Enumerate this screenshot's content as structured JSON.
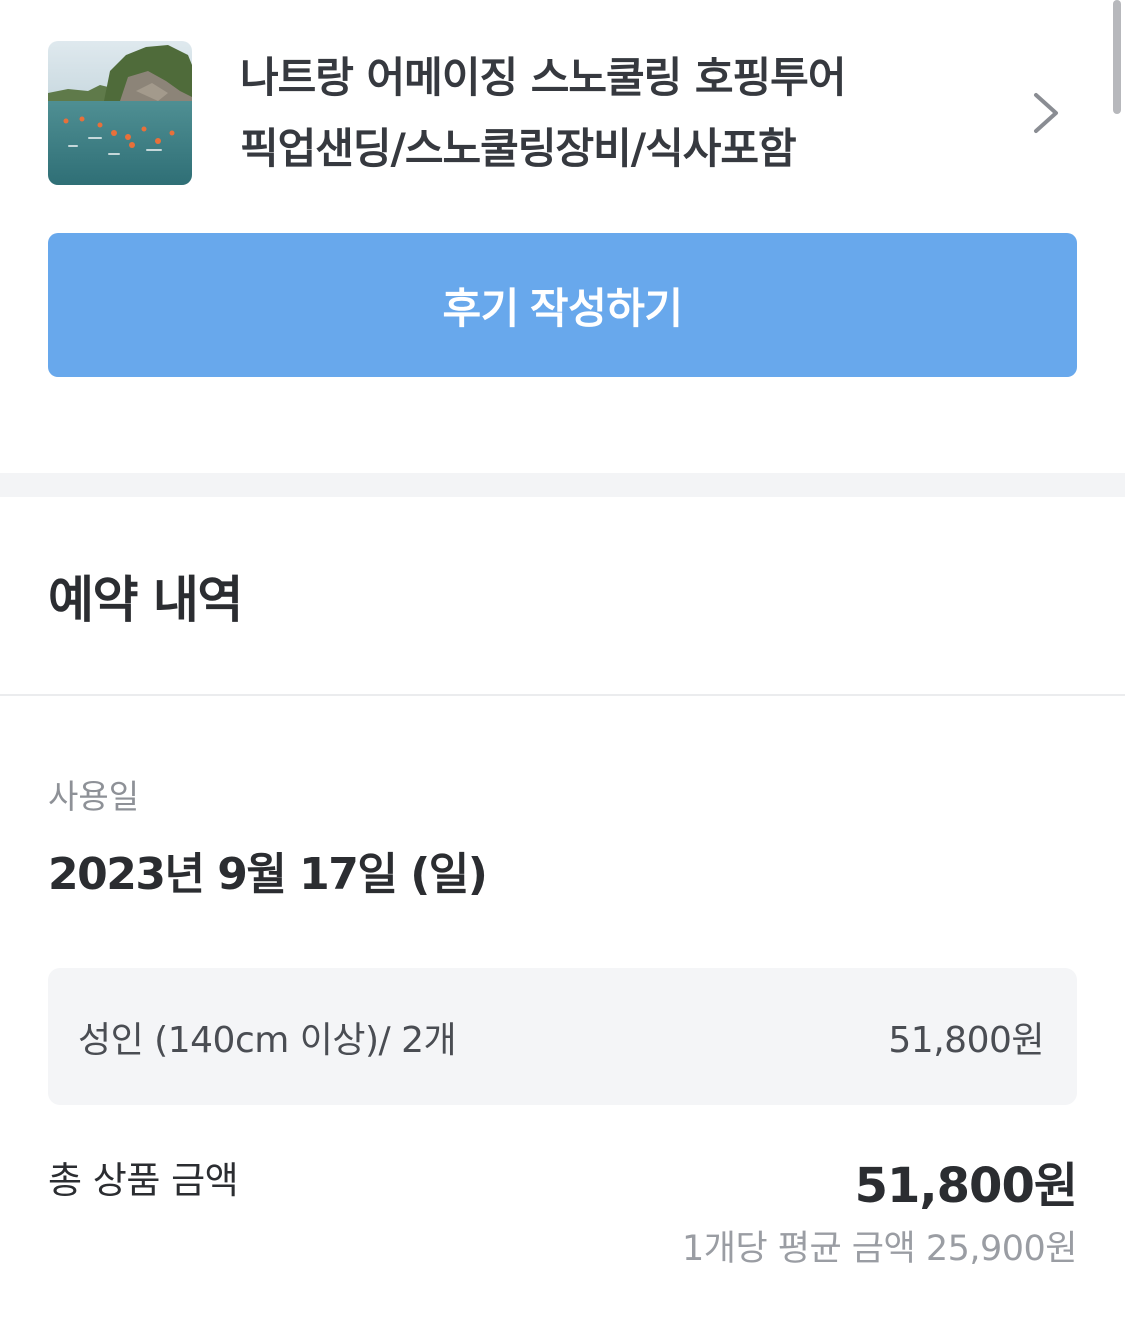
{
  "product": {
    "title_line1": "나트랑 어메이징 스노쿨링 호핑투어",
    "title_line2": "픽업샌딩/스노쿨링장비/식사포함"
  },
  "actions": {
    "review_label": "후기 작성하기"
  },
  "reservation": {
    "section_title": "예약 내역",
    "use_date_label": "사용일",
    "use_date": "2023년 9월 17일 (일)",
    "item": {
      "name": "성인 (140cm 이상)/ 2개",
      "price": "51,800원"
    },
    "total_label": "총 상품 금액",
    "total_price": "51,800원",
    "average": "1개당 평균 금액 25,900원"
  },
  "colors": {
    "accent": "#68a8ec",
    "section_gap": "#f3f4f6",
    "item_bg": "#f4f5f7"
  }
}
